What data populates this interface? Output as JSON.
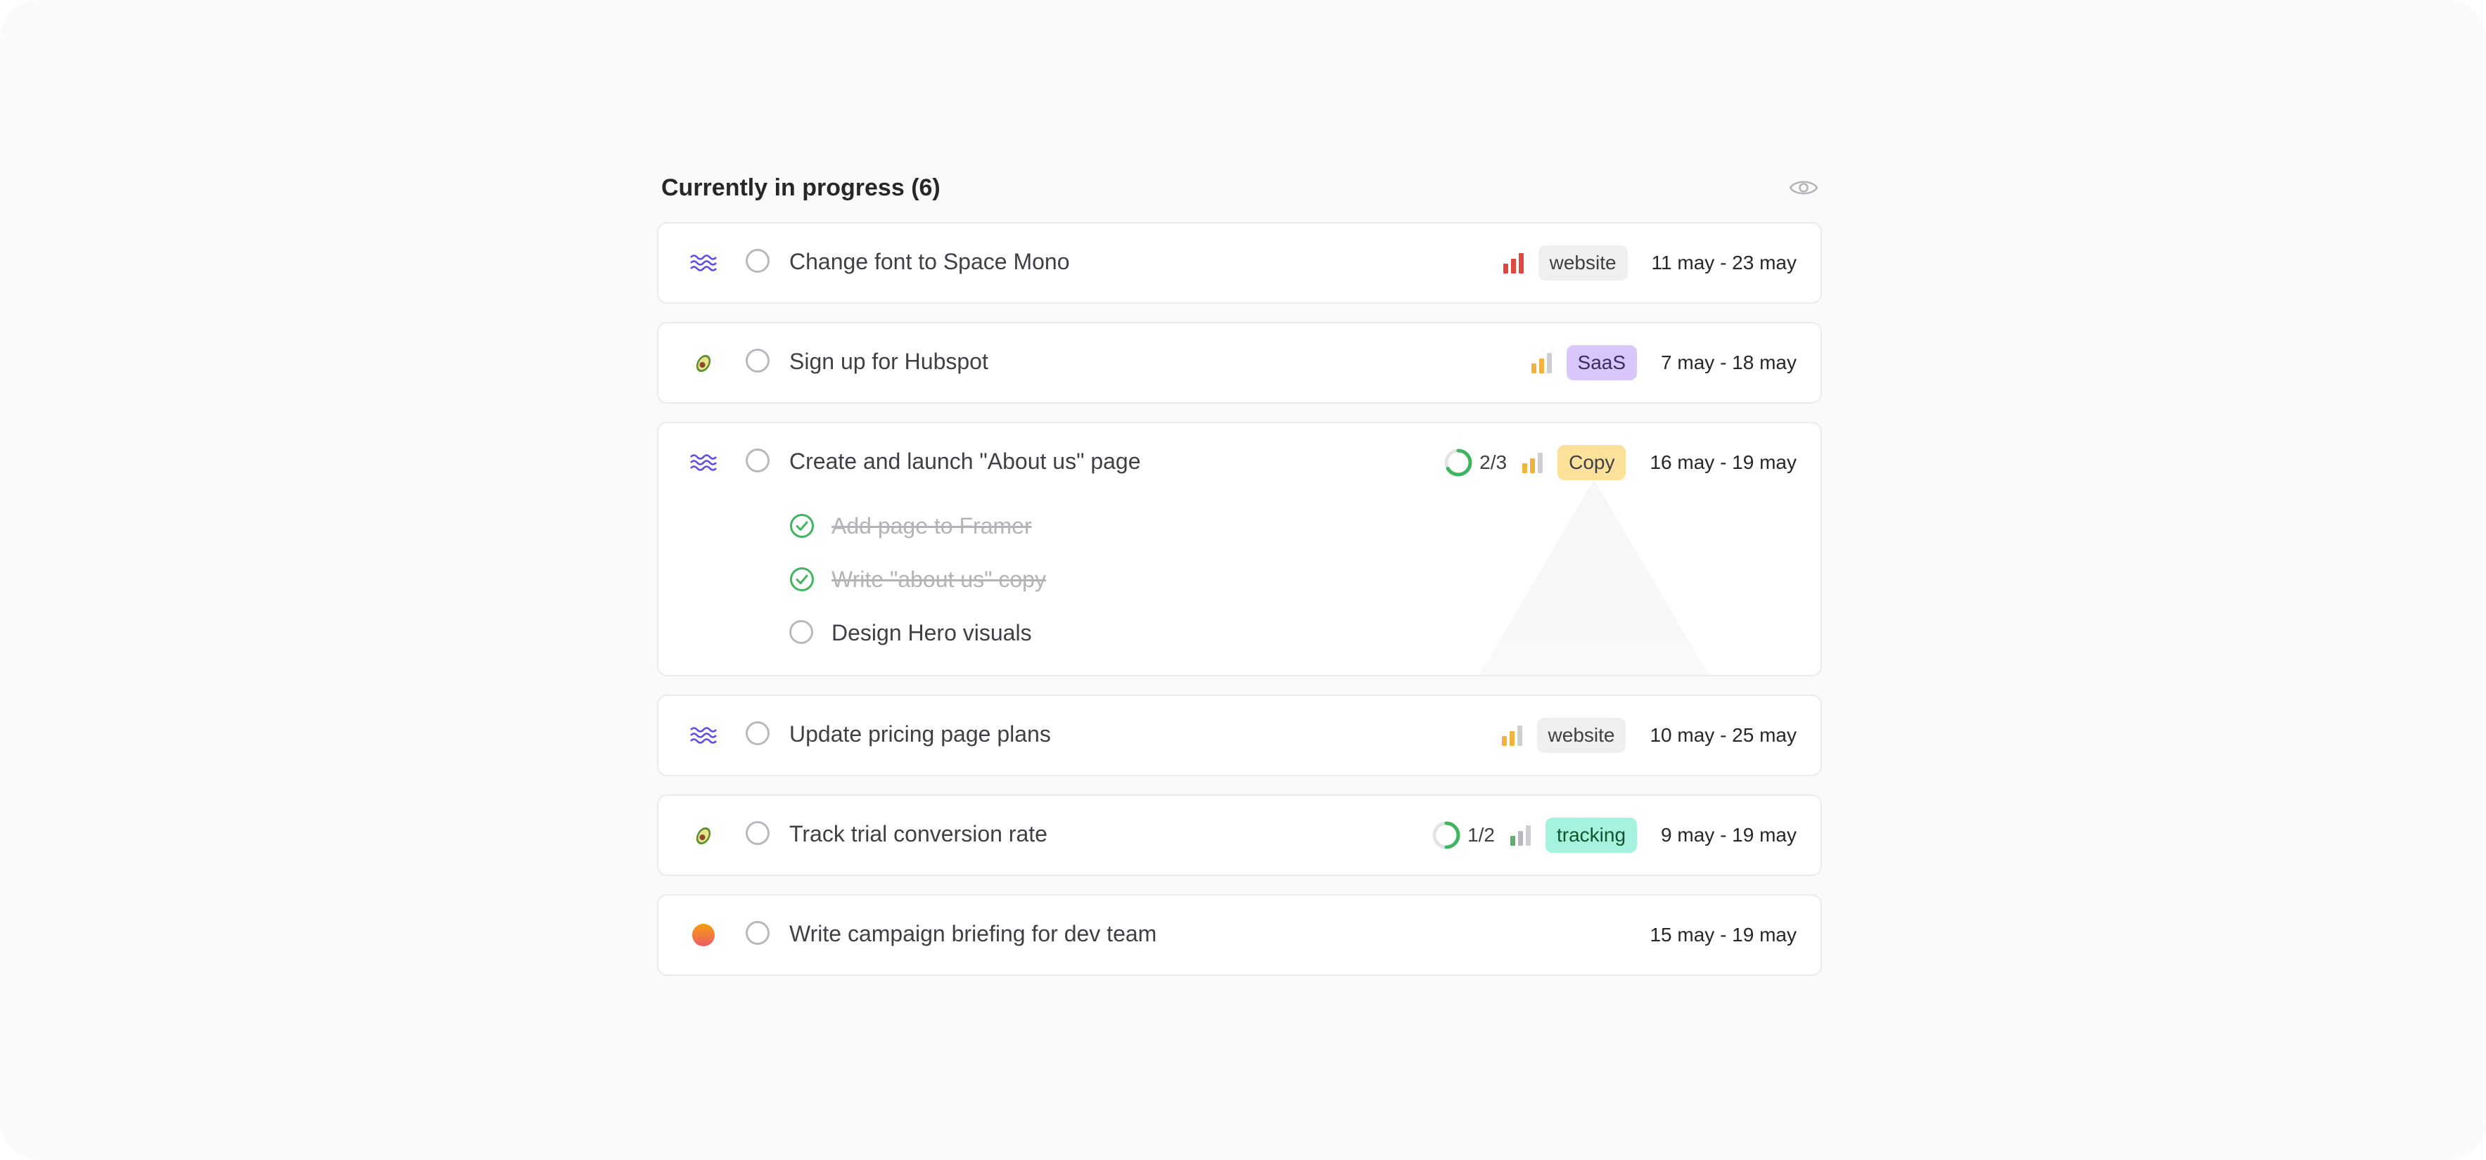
{
  "section": {
    "title": "Currently in progress (6)",
    "visibility_icon": "eye-icon"
  },
  "colors": {
    "wave": "#5b4de6",
    "priority_high": "#e0483e",
    "priority_medium": "#f2b23e",
    "priority_low": "#9ca3af",
    "done_check": "#3fb560",
    "tag_website": "#efefef",
    "tag_saas": "#d9c6fb",
    "tag_copy": "#fbe19a",
    "tag_tracking": "#a5f3df"
  },
  "tasks": [
    {
      "title": "Change font to Space Mono",
      "icon": "wave-icon",
      "priority": "high",
      "tag": "website",
      "date": "11 may - 23 may"
    },
    {
      "title": "Sign up for Hubspot",
      "icon": "avocado-icon",
      "priority": "medium",
      "tag": "SaaS",
      "date": "7 may - 18 may"
    },
    {
      "title": "Create and launch \"About us\" page",
      "icon": "wave-icon",
      "priority": "medium",
      "tag": "Copy",
      "date": "16 may - 19 may",
      "progress": {
        "text": "2/3",
        "fraction": 0.667
      },
      "subtasks": [
        {
          "title": "Add page to Framer",
          "done": true
        },
        {
          "title": "Write \"about us\" copy",
          "done": true
        },
        {
          "title": "Design Hero visuals",
          "done": false
        }
      ]
    },
    {
      "title": "Update pricing page plans",
      "icon": "wave-icon",
      "priority": "medium",
      "tag": "website",
      "date": "10 may - 25 may"
    },
    {
      "title": "Track trial conversion rate",
      "icon": "avocado-icon",
      "priority": "low",
      "tag": "tracking",
      "date": "9 may - 19 may",
      "progress": {
        "text": "1/2",
        "fraction": 0.5
      }
    },
    {
      "title": "Write campaign briefing for dev team",
      "icon": "sunset-icon",
      "date": "15 may - 19 may"
    }
  ]
}
